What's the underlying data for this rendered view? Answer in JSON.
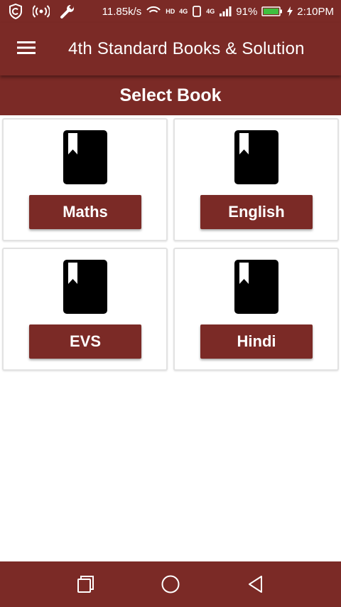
{
  "status_bar": {
    "speed": "11.85k/s",
    "hd_badge": "HD",
    "net_badge_1": "4G",
    "net_badge_2": "4G",
    "battery": "91%",
    "time": "2:10PM",
    "icons": [
      "shield-c-icon",
      "broadcast-icon",
      "wrench-icon",
      "wifi-hd-icon",
      "sim-icon",
      "phone-outline-icon",
      "signal-icon",
      "battery-icon",
      "charging-icon"
    ]
  },
  "app_bar": {
    "title": "4th Standard Books & Solution",
    "menu_icon": "hamburger-menu-icon"
  },
  "header": {
    "title": "Select Book"
  },
  "books": [
    {
      "label": "Maths",
      "icon": "book-bookmark-icon"
    },
    {
      "label": "English",
      "icon": "book-bookmark-icon"
    },
    {
      "label": "EVS",
      "icon": "book-bookmark-icon"
    },
    {
      "label": "Hindi",
      "icon": "book-bookmark-icon"
    }
  ],
  "nav_bar": {
    "icons": [
      "recents-square-icon",
      "home-circle-icon",
      "back-triangle-icon"
    ]
  },
  "colors": {
    "primary": "#7b2a26",
    "background": "#ffffff",
    "card_border": "#e2e2e2",
    "battery_fill": "#3fbf3f"
  }
}
